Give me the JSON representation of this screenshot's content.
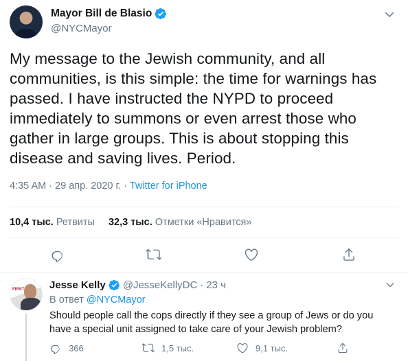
{
  "tweet": {
    "author_name": "Mayor Bill de Blasio",
    "author_handle": "@NYCMayor",
    "text": "My message to the Jewish community, and all communities, is this simple: the time for warnings has passed. I have instructed the NYPD to proceed immediately to summons or even arrest those who gather in large groups. This is about stopping this disease and saving lives. Period.",
    "time": "4:35 AM",
    "separator": "·",
    "date": "29 апр. 2020 г.",
    "source": "Twitter for iPhone",
    "retweets_count": "10,4 тыс.",
    "retweets_label": "Ретвиты",
    "likes_count": "32,3 тыс.",
    "likes_label": "Отметки «Нравится»"
  },
  "reply": {
    "author_name": "Jesse Kelly",
    "author_handle": "@JesseKellyDC",
    "separator": "·",
    "time_ago": "23 ч",
    "in_reply_prefix": "В ответ",
    "in_reply_to": "@NYCMayor",
    "avatar_logo": "FIRST",
    "text": "Should people call the cops directly if they see a group of Jews or do you have a special unit assigned to take care of your Jewish problem?",
    "reply_count": "366",
    "retweet_count": "1,5 тыс.",
    "like_count": "9,1 тыс."
  },
  "icons": {
    "verified": "verified-badge-icon",
    "menu": "chevron-down-icon",
    "reply": "reply-icon",
    "retweet": "retweet-icon",
    "like": "heart-icon",
    "share": "share-icon"
  },
  "colors": {
    "accent": "#1b95e0",
    "verified": "#1da1f2",
    "secondary_text": "#657786",
    "divider": "#e6ecf0"
  }
}
